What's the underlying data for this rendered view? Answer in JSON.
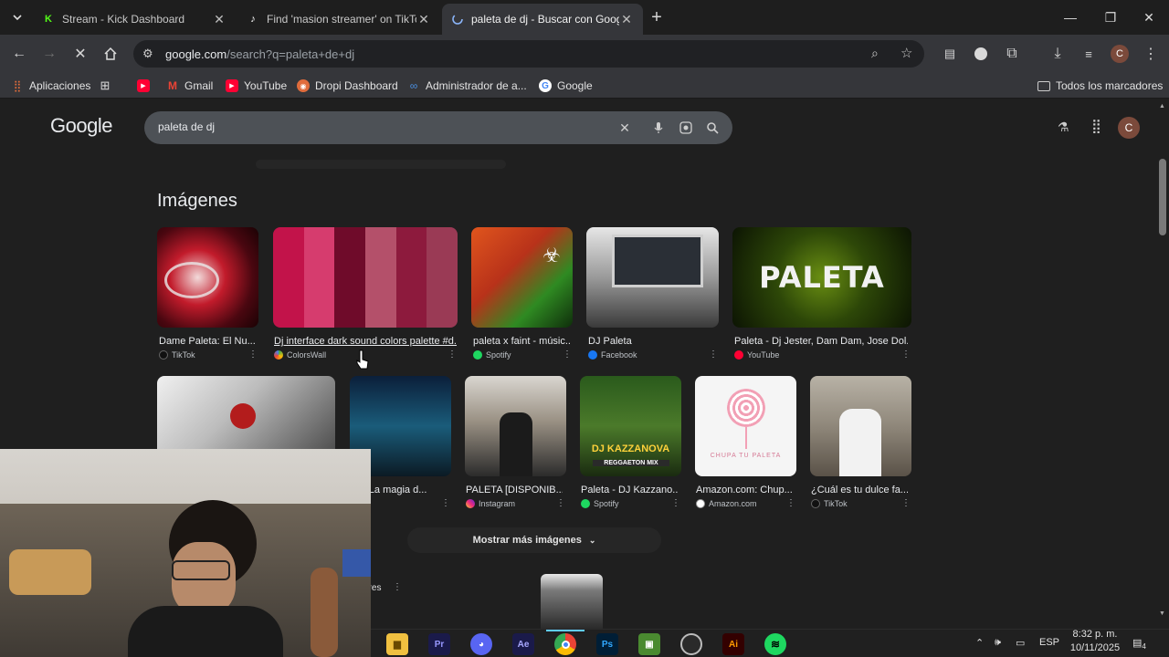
{
  "tabs": [
    {
      "title": "Stream - Kick Dashboard",
      "icon": "kick-icon"
    },
    {
      "title": "Find 'masion streamer' on TikTo",
      "icon": "tiktok-icon"
    },
    {
      "title": "paleta de dj - Buscar con Googl",
      "icon": "loading-icon"
    }
  ],
  "address": {
    "host": "google.com",
    "path": "/search?q=paleta+de+dj"
  },
  "bookmarks": [
    "Aplicaciones",
    "Gmail",
    "YouTube",
    "Dropi Dashboard",
    "Administrador de a...",
    "Google"
  ],
  "bookmarks_all": "Todos los marcadores",
  "google": {
    "logo": "Google",
    "query": "paleta de dj",
    "avatar": "C"
  },
  "images_heading": "Imágenes",
  "row1": [
    {
      "caption": "Dame Paleta: El Nu...",
      "source": "TikTok"
    },
    {
      "caption": "Dj interface dark sound colors palette #d...",
      "source": "ColorsWall"
    },
    {
      "caption": "paleta x faint - músic...",
      "source": "Spotify"
    },
    {
      "caption": "DJ Paleta",
      "source": "Facebook"
    },
    {
      "caption": "Paleta - Dj Jester, Dam Dam, Jose Dol...",
      "source": "YouTube"
    }
  ],
  "row2": [
    {
      "caption": "2G: La magia d...",
      "source": "ikTok"
    },
    {
      "caption": "PALETA [DISPONIB...",
      "source": "Instagram"
    },
    {
      "caption": "Paleta - DJ Kazzano...",
      "source": "Spotify"
    },
    {
      "caption": "Amazon.com: Chup...",
      "source": "Amazon.com"
    },
    {
      "caption": "¿Cuál es tu dulce fa...",
      "source": "TikTok"
    }
  ],
  "thumb_texts": {
    "paleta": "PALETA",
    "kazzanova": "DJ KAZZANOVA",
    "reggaeton": "REGGAETON MIX",
    "chupa": "CHUPA TU PALETA"
  },
  "show_more": "Mostrar más imágenes",
  "partial_label": "ores",
  "taskbar": {
    "lang": "ESP",
    "time": "8:32 p. m.",
    "date": "10/11/2025",
    "notif": "4"
  },
  "colors": {
    "palette": [
      "#c2134a",
      "#d63c6e",
      "#6f0b2a",
      "#b4506a",
      "#8d1a3d",
      "#9a3a55"
    ]
  }
}
